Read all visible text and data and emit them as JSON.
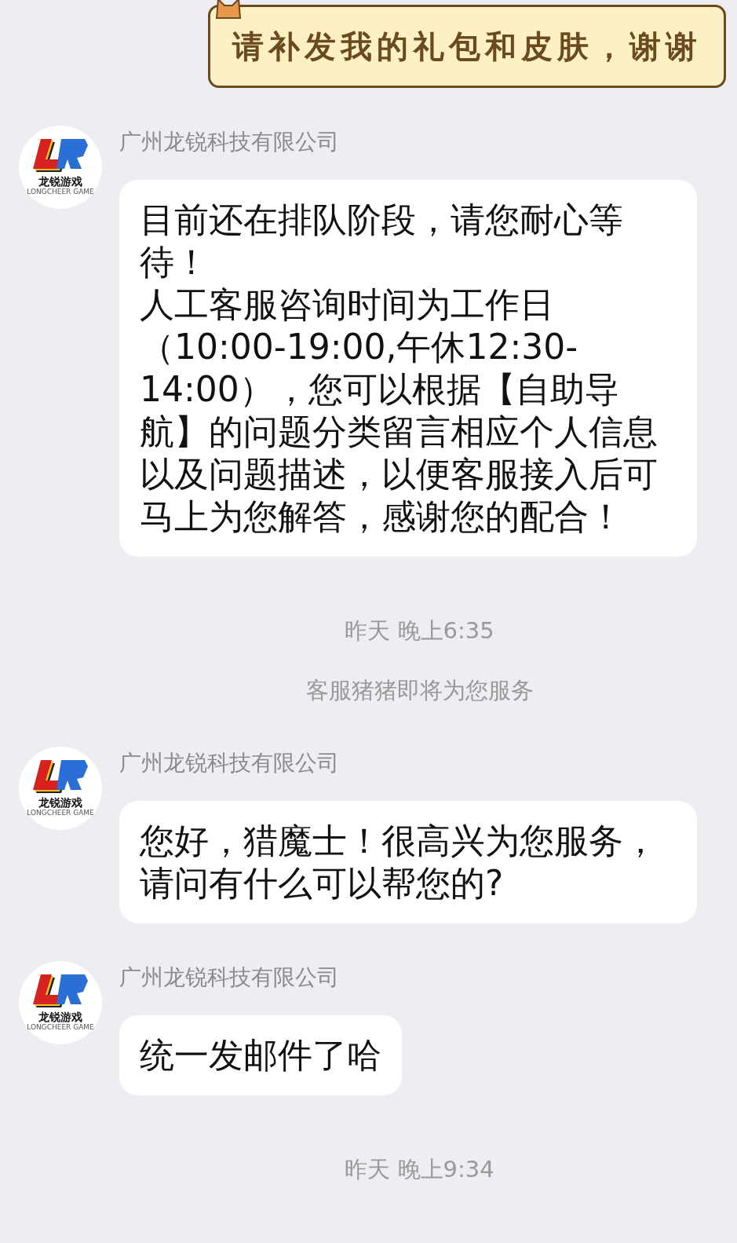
{
  "sticker_message": {
    "text": "请补发我的礼包和皮肤，谢谢"
  },
  "messages": [
    {
      "kind": "agent",
      "sender": "广州龙锐科技有限公司",
      "avatar": {
        "title": "龙锐游戏",
        "subtitle": "LONGCHEER GAME"
      },
      "paragraphs": [
        "目前还在排队阶段，请您耐心等待！",
        "人工客服咨询时间为工作日（10:00-19:00,午休12:30-14:00），您可以根据【自助导航】的问题分类留言相应个人信息以及问题描述，以便客服接入后可马上为您解答，感谢您的配合！"
      ]
    },
    {
      "kind": "time",
      "text": "昨天 晚上6:35"
    },
    {
      "kind": "notice",
      "text": "客服猪猪即将为您服务"
    },
    {
      "kind": "agent",
      "sender": "广州龙锐科技有限公司",
      "avatar": {
        "title": "龙锐游戏",
        "subtitle": "LONGCHEER GAME"
      },
      "paragraphs": [
        "您好，猎魔士！很高兴为您服务，请问有什么可以帮您的?"
      ]
    },
    {
      "kind": "agent",
      "sender": "广州龙锐科技有限公司",
      "avatar": {
        "title": "龙锐游戏",
        "subtitle": "LONGCHEER GAME"
      },
      "paragraphs": [
        "统一发邮件了哈"
      ]
    },
    {
      "kind": "time",
      "text": "昨天 晚上9:34"
    }
  ]
}
